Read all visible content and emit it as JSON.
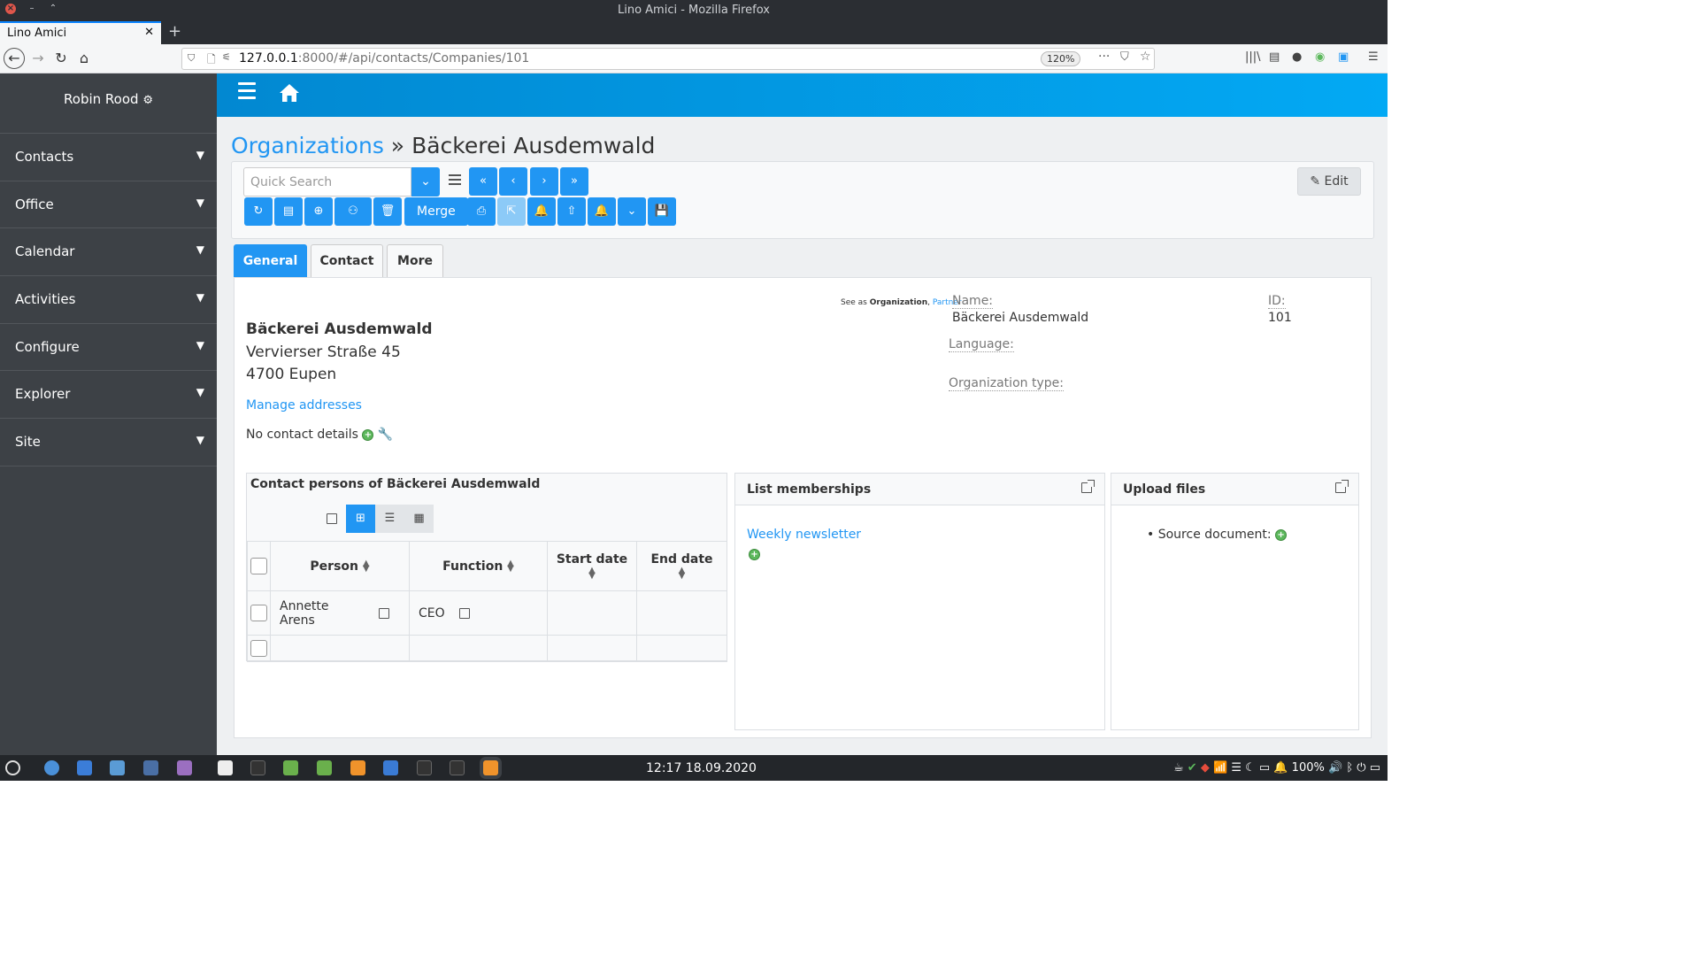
{
  "browser": {
    "window_title": "Lino Amici - Mozilla Firefox",
    "tab_title": "Lino Amici",
    "url_host": "127.0.0.1",
    "url_rest": ":8000/#/api/contacts/Companies/101",
    "zoom": "120%"
  },
  "sidebar": {
    "user": "Robin Rood",
    "items": [
      {
        "label": "Contacts"
      },
      {
        "label": "Office"
      },
      {
        "label": "Calendar"
      },
      {
        "label": "Activities"
      },
      {
        "label": "Configure"
      },
      {
        "label": "Explorer"
      },
      {
        "label": "Site"
      }
    ]
  },
  "breadcrumb": {
    "parent": "Organizations",
    "separator": " » ",
    "current": "Bäckerei Ausdemwald"
  },
  "toolbar": {
    "search_placeholder": "Quick Search",
    "merge_label": "Merge",
    "edit_label": "Edit"
  },
  "tabs": [
    {
      "label": "General",
      "active": true
    },
    {
      "label": "Contact",
      "active": false
    },
    {
      "label": "More",
      "active": false
    }
  ],
  "general": {
    "see_as_prefix": "See as",
    "see_as_bold": "Organization",
    "see_as_link": "Partner",
    "address": {
      "name": "Bäckerei Ausdemwald",
      "street": "Vervierser Straße 45",
      "city": "4700 Eupen"
    },
    "manage_addresses": "Manage addresses",
    "no_contact": "No contact details",
    "fields": {
      "name_label": "Name:",
      "name_value": "Bäckerei Ausdemwald",
      "id_label": "ID:",
      "id_value": "101",
      "language_label": "Language:",
      "orgtype_label": "Organization type:"
    }
  },
  "contact_persons": {
    "title": "Contact persons of Bäckerei Ausdemwald",
    "columns": [
      "Person",
      "Function",
      "Start date",
      "End date"
    ],
    "rows": [
      {
        "person": "Annette Arens",
        "function": "CEO",
        "start": "",
        "end": ""
      }
    ]
  },
  "list_memberships": {
    "title": "List memberships",
    "items": [
      "Weekly newsletter"
    ]
  },
  "upload_files": {
    "title": "Upload files",
    "item": "Source document:"
  },
  "taskbar": {
    "clock": "12:17  18.09.2020",
    "battery": "100%"
  },
  "colors": {
    "accent": "#2196f3",
    "sidebar_bg": "#3d4146",
    "topbar_bg": "#03a9f4"
  }
}
